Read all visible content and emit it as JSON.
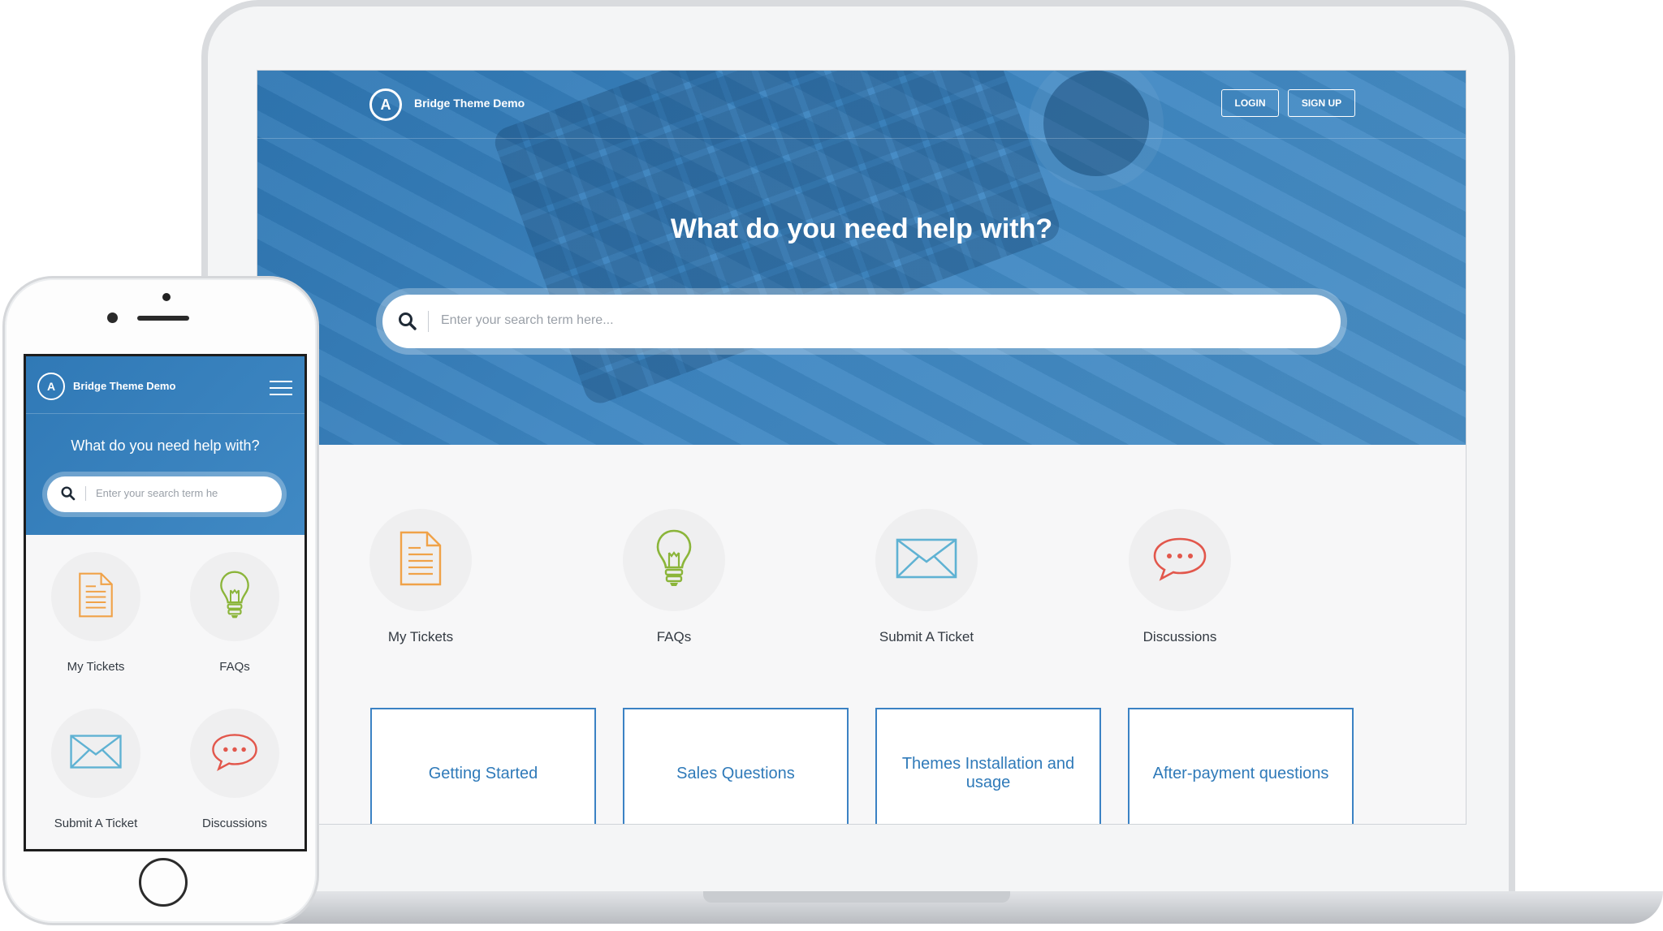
{
  "brand": {
    "name": "Bridge Theme Demo",
    "logo_letter": "A"
  },
  "nav": {
    "login_label": "LOGIN",
    "signup_label": "SIGN UP"
  },
  "hero": {
    "title": "What do you need help with?"
  },
  "search": {
    "placeholder": "Enter your search term here..."
  },
  "categories": [
    {
      "label": "My Tickets",
      "icon": "document-icon"
    },
    {
      "label": "FAQs",
      "icon": "lightbulb-icon"
    },
    {
      "label": "Submit A Ticket",
      "icon": "envelope-icon"
    },
    {
      "label": "Discussions",
      "icon": "chat-bubble-icon"
    }
  ],
  "topics": [
    {
      "label": "Getting Started"
    },
    {
      "label": "Sales Questions"
    },
    {
      "label": "Themes Installation and usage"
    },
    {
      "label": "After-payment questions"
    }
  ],
  "mobile": {
    "brand_name": "Bridge Theme Demo",
    "title": "What do you need help with?",
    "search_placeholder": "Enter your search term he",
    "categories": [
      {
        "label": "My Tickets"
      },
      {
        "label": "FAQs"
      },
      {
        "label": "Submit A Ticket"
      },
      {
        "label": "Discussions"
      }
    ]
  },
  "colors": {
    "primary_blue": "#3a83c0",
    "topic_text": "#2f7ab9",
    "doc_orange": "#f0a248",
    "bulb_green": "#8bb53a",
    "envelope_blue": "#5fb2d3",
    "chat_red": "#e2574c"
  }
}
